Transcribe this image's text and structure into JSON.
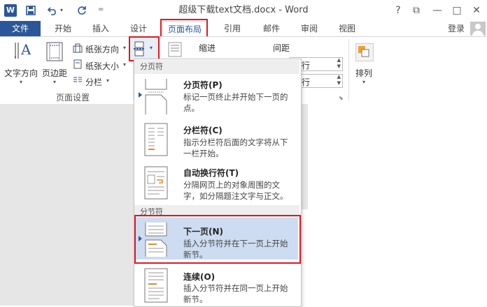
{
  "window": {
    "title": "超级下载text文档.docx - Word",
    "help_label": "?",
    "restore_label": "⧉",
    "minimize_label": "—",
    "maximize_label": "□",
    "close_label": "✕"
  },
  "qat": {
    "save": "💾",
    "undo": "↶",
    "redo": "↺",
    "customize": "≡"
  },
  "tabs": {
    "file": "文件",
    "home": "开始",
    "insert": "插入",
    "design": "设计",
    "layout": "页面布局",
    "references": "引用",
    "mailings": "邮件",
    "review": "审阅",
    "view": "视图",
    "login": "登录"
  },
  "ribbon": {
    "text_direction": "文字方向",
    "margins": "页边距",
    "orientation": "纸张方向",
    "size": "纸张大小",
    "columns": "分栏",
    "page_setup_group": "页面设置",
    "indent": "缩进",
    "spacing": "间距",
    "spin1": "行",
    "spin2": "行",
    "arrange": "排列"
  },
  "menu": {
    "page_breaks_header": "分页符",
    "section_breaks_header": "分节符",
    "items": [
      {
        "title": "分页符(P)",
        "desc1": "标记一页终止并开始下一页的",
        "desc2": "点。"
      },
      {
        "title": "分栏符(C)",
        "desc1": "指示分栏符后面的文字将从下",
        "desc2": "一栏开始。"
      },
      {
        "title": "自动换行符(T)",
        "desc1": "分隔网页上的对象周围的文",
        "desc2": "字，如分隔题注文字与正文。"
      },
      {
        "title": "下一页(N)",
        "desc1": "插入分节符并在下一页上开始",
        "desc2": "新节。"
      },
      {
        "title": "连续(O)",
        "desc1": "插入分节符并在同一页上开始",
        "desc2": "新节。"
      }
    ]
  },
  "colors": {
    "accent": "#2b579a",
    "highlight": "#e0181e",
    "selected": "#cddcf0"
  }
}
